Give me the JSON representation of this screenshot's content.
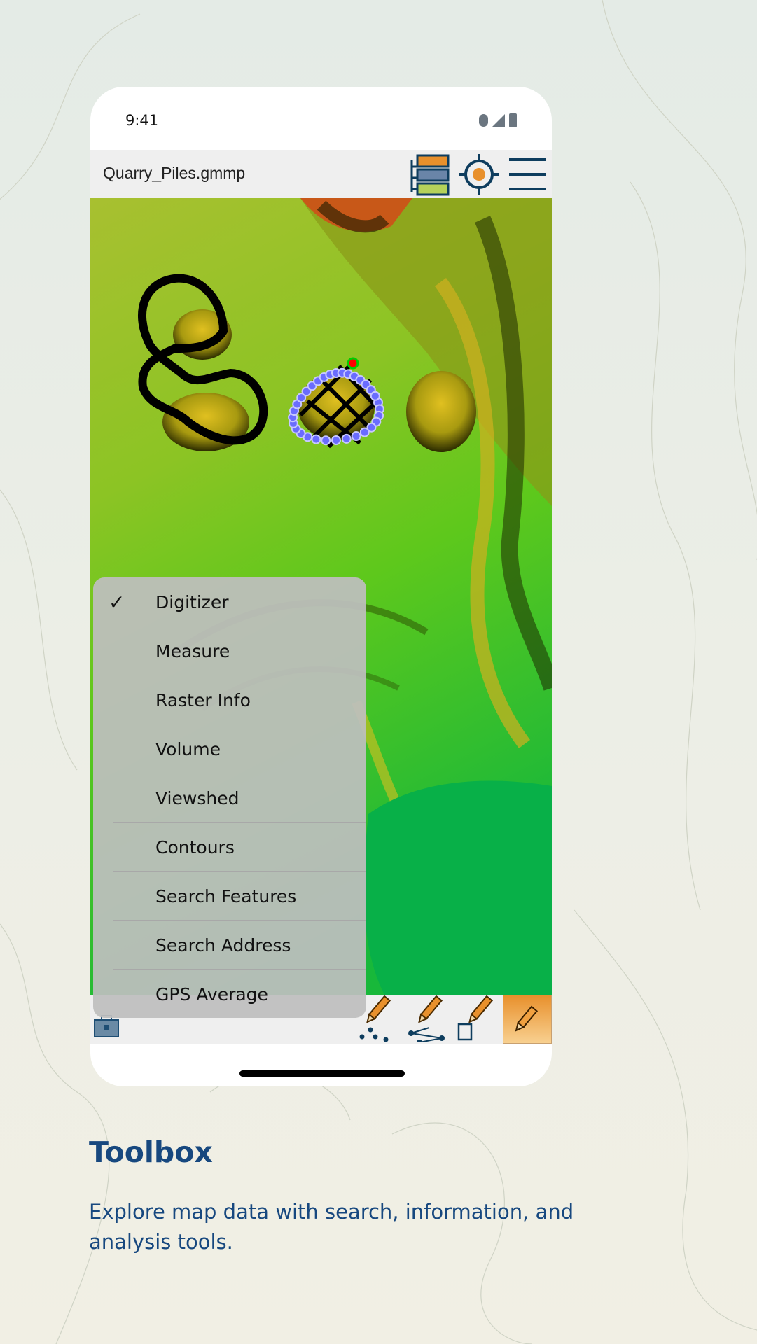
{
  "status_bar": {
    "time": "9:41"
  },
  "header": {
    "title": "Quarry_Piles.gmmp",
    "icons": [
      "layers-icon",
      "gps-locate-icon",
      "menu-icon"
    ]
  },
  "menu": {
    "items": [
      {
        "label": "Digitizer",
        "checked": true
      },
      {
        "label": "Measure",
        "checked": false
      },
      {
        "label": "Raster Info",
        "checked": false
      },
      {
        "label": "Volume",
        "checked": false
      },
      {
        "label": "Viewshed",
        "checked": false
      },
      {
        "label": "Contours",
        "checked": false
      },
      {
        "label": "Search Features",
        "checked": false
      },
      {
        "label": "Search Address",
        "checked": false
      },
      {
        "label": "GPS Average",
        "checked": false
      }
    ],
    "check_glyph": "✓"
  },
  "toolbar": {
    "icons": [
      "toolbox-icon",
      "draw-points-icon",
      "draw-line-icon",
      "draw-area-icon",
      "edit-pencil-icon"
    ],
    "active": "edit-pencil-icon"
  },
  "caption": {
    "title": "Toolbox",
    "subtitle": "Explore map data with search, information, and analysis tools."
  },
  "colors": {
    "brand": "#17487f",
    "accent": "#e8902c",
    "active_tool": "#f2b462"
  }
}
